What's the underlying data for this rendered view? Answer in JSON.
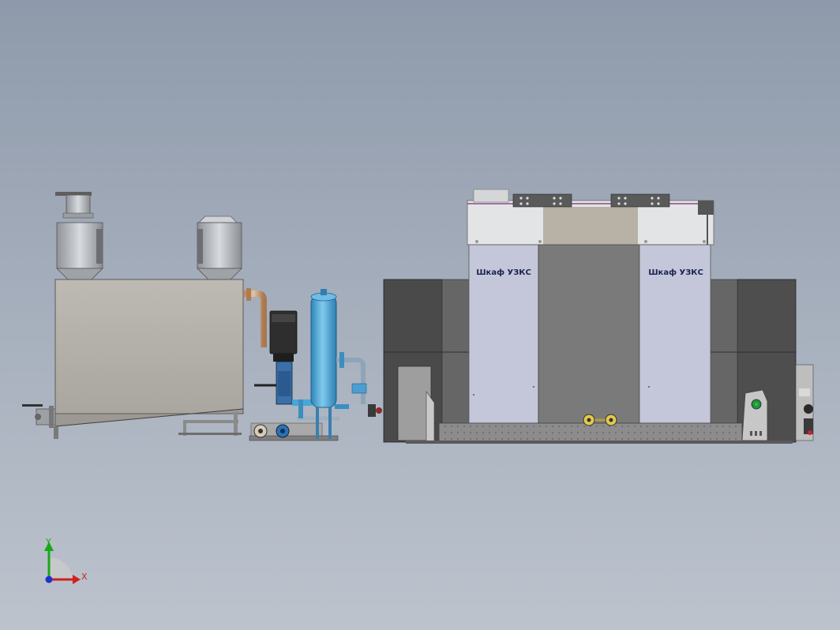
{
  "view": {
    "cabinet_labels": [
      "Шкаф УЗКС",
      "Шкаф УЗКС"
    ]
  },
  "triad": {
    "x_label": "X",
    "y_label": "Y",
    "x_color": "#d02020",
    "y_color": "#18a818",
    "z_color": "#2030d0"
  },
  "colors": {
    "tank_body": "#b4b1ab",
    "stainless": "#b9bcc0",
    "dark_steel": "#4a4a4a",
    "cabinet_panel": "#c3c7d9",
    "accumulator_blue": "#4aa6d6",
    "pump_blue": "#2a72b6",
    "copper_pipe": "#c89a72"
  }
}
